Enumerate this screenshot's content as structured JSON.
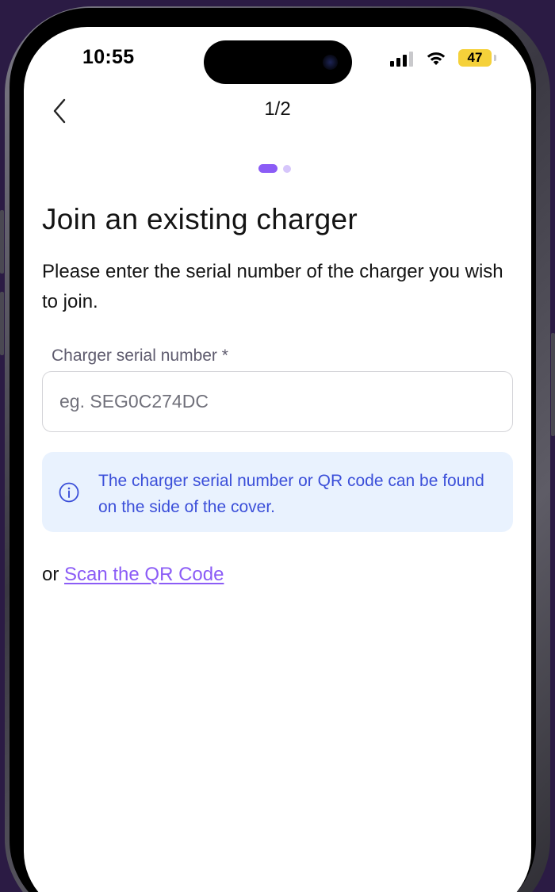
{
  "status_bar": {
    "time": "10:55",
    "battery_level": "47",
    "icons": [
      "cellular-signal-icon",
      "wifi-icon",
      "battery-icon"
    ]
  },
  "nav": {
    "back_icon": "chevron-left-icon",
    "step": "1/2"
  },
  "progress": {
    "current_step": 1,
    "total_steps": 2
  },
  "page": {
    "title": "Join an existing charger",
    "intro": "Please enter the serial number of the charger you wish to join."
  },
  "serial_field": {
    "label": "Charger serial number *",
    "placeholder": "eg. SEG0C274DC",
    "value": ""
  },
  "info": {
    "icon": "info-circle-icon",
    "text": "The charger serial number or QR code can be found on the side of the cover."
  },
  "alternative": {
    "prefix": "or ",
    "link_text": "Scan the QR Code"
  },
  "colors": {
    "accent": "#8b5cf6",
    "accent_light": "#d6c6fb",
    "info_bg": "#e9f2fe",
    "info_text": "#3b4fd9",
    "battery": "#f5d13a",
    "backdrop": "#2b1b44"
  }
}
